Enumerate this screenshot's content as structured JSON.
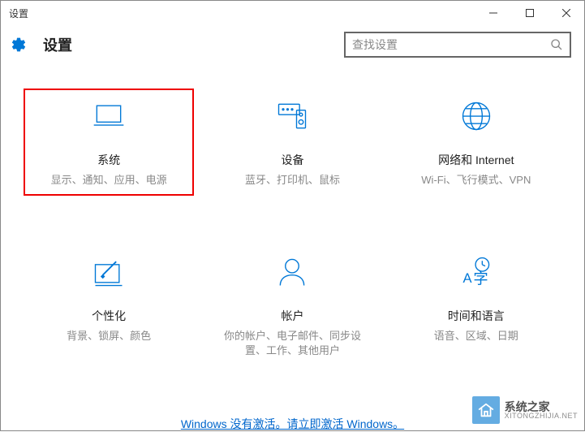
{
  "window": {
    "title": "设置"
  },
  "header": {
    "title": "设置"
  },
  "search": {
    "placeholder": "查找设置"
  },
  "tiles": [
    {
      "title": "系统",
      "desc": "显示、通知、应用、电源"
    },
    {
      "title": "设备",
      "desc": "蓝牙、打印机、鼠标"
    },
    {
      "title": "网络和 Internet",
      "desc": "Wi-Fi、飞行模式、VPN"
    },
    {
      "title": "个性化",
      "desc": "背景、锁屏、颜色"
    },
    {
      "title": "帐户",
      "desc": "你的帐户、电子邮件、同步设置、工作、其他用户"
    },
    {
      "title": "时间和语言",
      "desc": "语音、区域、日期"
    }
  ],
  "activation": {
    "text": "Windows 没有激活。请立即激活 Windows。"
  },
  "watermark": {
    "cn": "系统之家",
    "en": "XITONGZHIJIA.NET"
  }
}
